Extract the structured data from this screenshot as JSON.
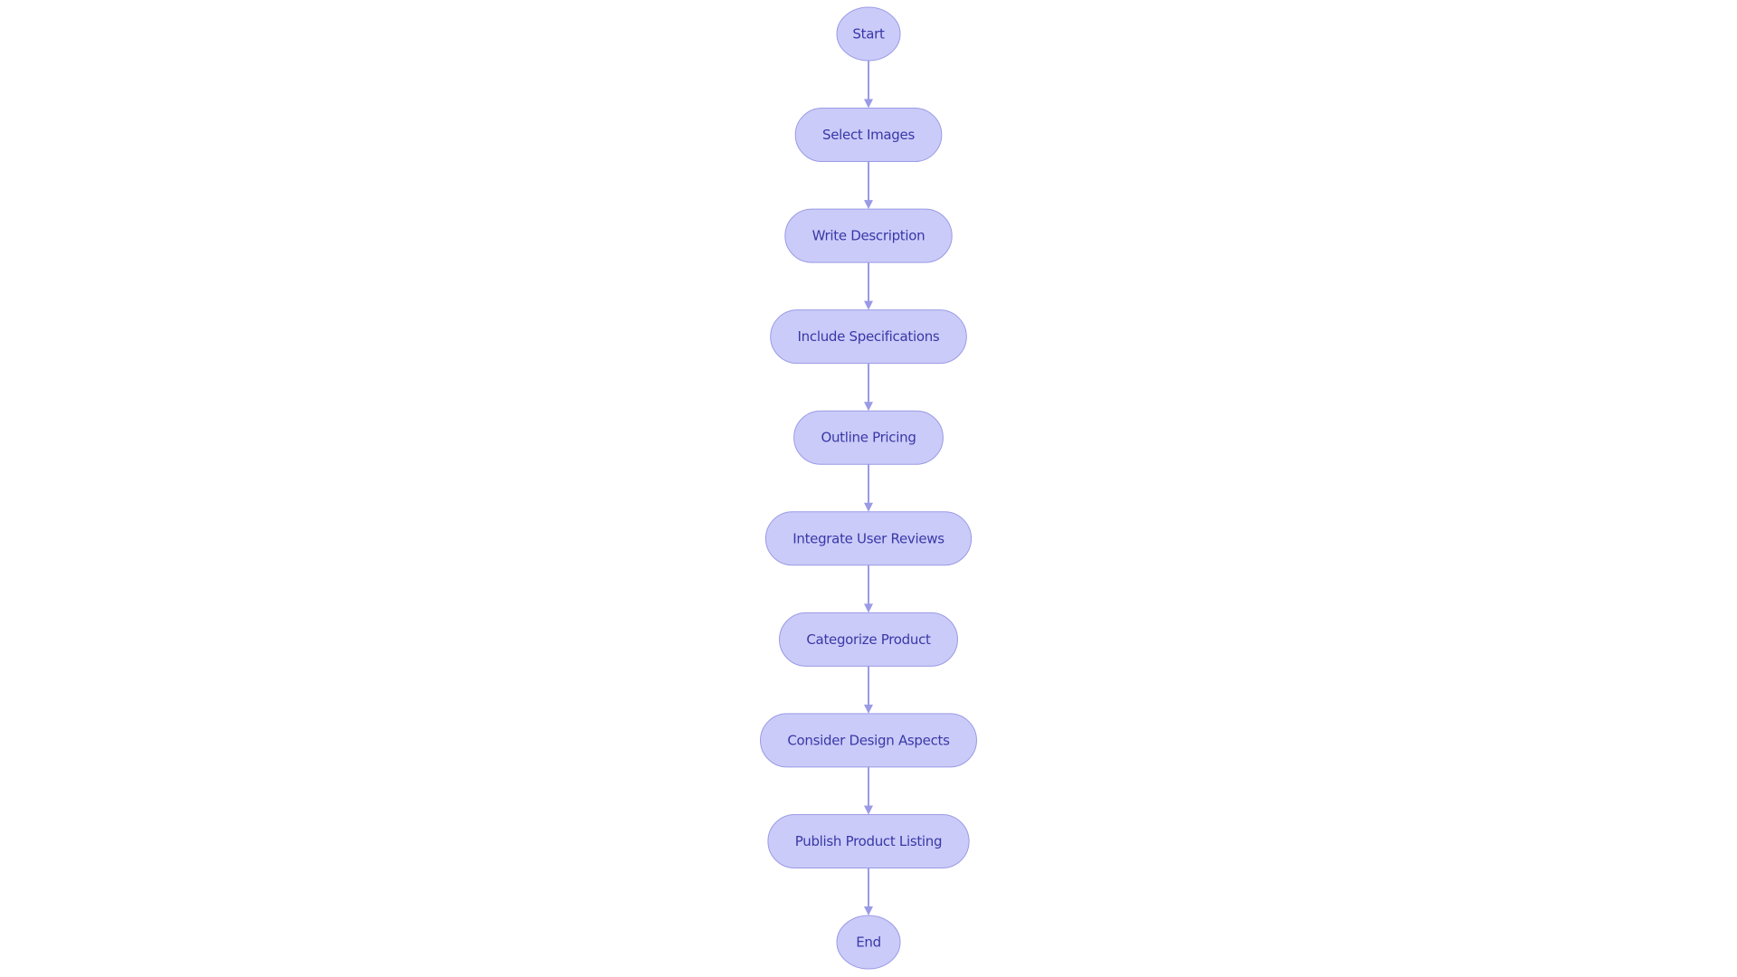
{
  "diagram": {
    "type": "flowchart",
    "direction": "top-to-bottom",
    "colors": {
      "node_fill": "#CBCBF9",
      "node_stroke": "#9A9AE6",
      "edge": "#9A9AE6",
      "text": "#3838A8",
      "background": "#FFFFFF"
    },
    "nodes": [
      {
        "id": "start",
        "label": "Start",
        "shape": "circle"
      },
      {
        "id": "select-images",
        "label": "Select Images",
        "shape": "stadium"
      },
      {
        "id": "write-description",
        "label": "Write Description",
        "shape": "stadium"
      },
      {
        "id": "include-specifications",
        "label": "Include Specifications",
        "shape": "stadium"
      },
      {
        "id": "outline-pricing",
        "label": "Outline Pricing",
        "shape": "stadium"
      },
      {
        "id": "integrate-user-reviews",
        "label": "Integrate User Reviews",
        "shape": "stadium"
      },
      {
        "id": "categorize-product",
        "label": "Categorize Product",
        "shape": "stadium"
      },
      {
        "id": "consider-design-aspects",
        "label": "Consider Design Aspects",
        "shape": "stadium"
      },
      {
        "id": "publish-product-listing",
        "label": "Publish Product Listing",
        "shape": "stadium"
      },
      {
        "id": "end",
        "label": "End",
        "shape": "circle"
      }
    ],
    "edges": [
      {
        "from": "start",
        "to": "select-images"
      },
      {
        "from": "select-images",
        "to": "write-description"
      },
      {
        "from": "write-description",
        "to": "include-specifications"
      },
      {
        "from": "include-specifications",
        "to": "outline-pricing"
      },
      {
        "from": "outline-pricing",
        "to": "integrate-user-reviews"
      },
      {
        "from": "integrate-user-reviews",
        "to": "categorize-product"
      },
      {
        "from": "categorize-product",
        "to": "consider-design-aspects"
      },
      {
        "from": "consider-design-aspects",
        "to": "publish-product-listing"
      },
      {
        "from": "publish-product-listing",
        "to": "end"
      }
    ]
  }
}
